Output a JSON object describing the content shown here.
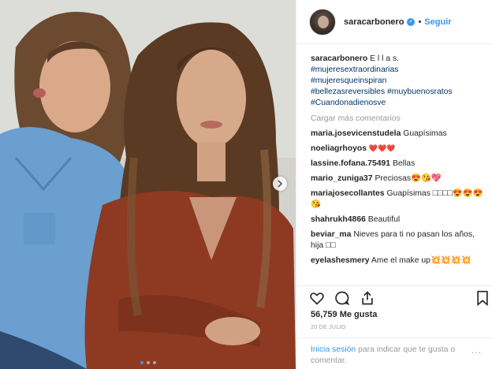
{
  "header": {
    "username": "saracarbonero",
    "separator": "•",
    "follow_label": "Seguir"
  },
  "caption": {
    "username": "saracarbonero",
    "text": "E l l a s.",
    "hashtags": [
      "#mujeresextraordinarias",
      "#mujeresqueinspiran",
      "#bellezasreversibles #muybuenosratos",
      "#Cuandonadienosve"
    ]
  },
  "load_more_label": "Cargar más comentarios",
  "comments": [
    {
      "user": "maria.josevicenstudela",
      "text": "Guapísimas"
    },
    {
      "user": "noeliagrhoyos",
      "text": "❤️❤️❤️"
    },
    {
      "user": "lassine.fofana.75491",
      "text": "Bellas"
    },
    {
      "user": "mario_zuniga37",
      "text": "Preciosas😍😘💖"
    },
    {
      "user": "mariajosecollantes",
      "text": "Guapísimas □□□□😍😍😍😘"
    },
    {
      "user": "shahrukh4866",
      "text": "Beautiful"
    },
    {
      "user": "beviar_ma",
      "text": "Nieves para ti no pasan los años, hija □□"
    },
    {
      "user": "eyelashesmery",
      "text": "Ame el make up💥💥💥💥"
    }
  ],
  "likes": "56,759 Me gusta",
  "date": "20 DE JULIO",
  "login_prompt": {
    "link": "Inicia sesión",
    "text": " para indicar que te gusta o comentar."
  },
  "more_label": "...",
  "icons": [
    "heart-icon",
    "comment-icon",
    "share-icon",
    "bookmark-icon",
    "next-arrow-icon",
    "verified-badge-icon"
  ],
  "colors": {
    "accent": "#3897f0",
    "text": "#262626",
    "muted": "#999999",
    "hashtag": "#003569"
  }
}
